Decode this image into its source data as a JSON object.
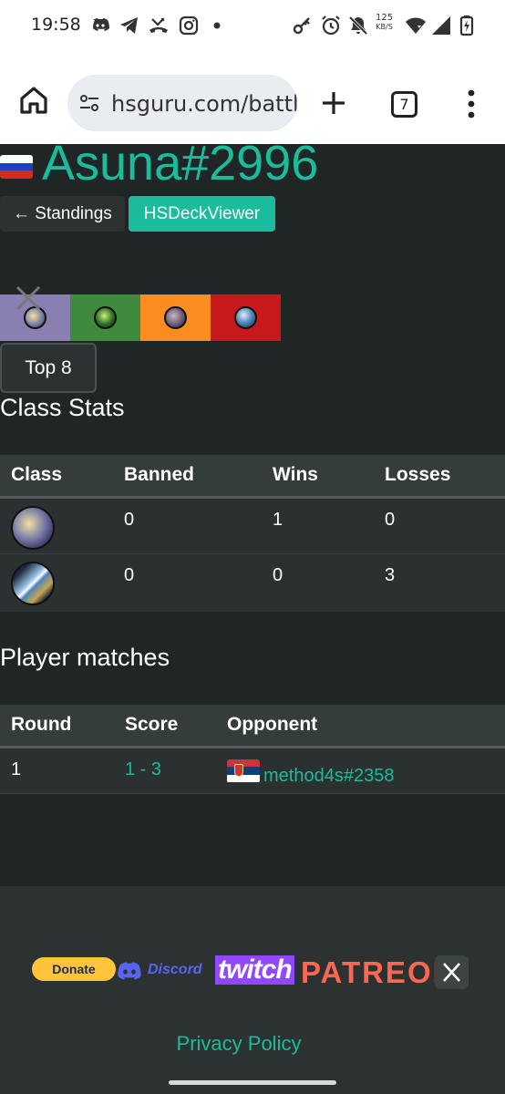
{
  "status_bar": {
    "time": "19:58",
    "net_speed_value": "125",
    "net_speed_unit": "KB/S",
    "icons": [
      "discord-icon",
      "telegram-icon",
      "missed-call-icon",
      "instagram-icon",
      "dot-icon",
      "key-icon",
      "alarm-icon",
      "mute-icon",
      "wifi-icon",
      "signal-icon",
      "battery-charging-icon"
    ]
  },
  "browser": {
    "url": "hsguru.com/battl",
    "tab_count": "7"
  },
  "player": {
    "flag": "russia-flag",
    "name": "Asuna#2996"
  },
  "nav": {
    "standings_label": "← Standings",
    "viewer_label": "HSDeckViewer"
  },
  "class_strip": {
    "classes": [
      {
        "name": "paladin-icon",
        "color": "#8a7fb1"
      },
      {
        "name": "druid-icon",
        "color": "#3f8a3c"
      },
      {
        "name": "rogue-icon",
        "color": "#fb8c1f"
      },
      {
        "name": "warrior-icon",
        "color": "#c8191c"
      }
    ]
  },
  "top8_label": "Top 8",
  "class_stats": {
    "title": "Class Stats",
    "headers": [
      "Class",
      "Banned",
      "Wins",
      "Losses"
    ],
    "rows": [
      {
        "class_icon": "paladin-icon",
        "banned": "0",
        "wins": "1",
        "losses": "0"
      },
      {
        "class_icon": "warrior-icon",
        "banned": "0",
        "wins": "0",
        "losses": "3"
      }
    ]
  },
  "player_matches": {
    "title": "Player matches",
    "headers": [
      "Round",
      "Score",
      "Opponent"
    ],
    "rows": [
      {
        "round": "1",
        "score": "1 - 3",
        "opponent_flag": "serbia-flag",
        "opponent": "method4s#2358"
      }
    ]
  },
  "footer": {
    "donate_label": "Donate",
    "discord_label": "Discord",
    "twitch_label": "twitch",
    "patreon_label": "PATREON",
    "privacy_label": "Privacy Policy"
  },
  "colors": {
    "accent": "#1abc9c",
    "page_bg": "#202625",
    "panel_bg": "#2b3231"
  }
}
